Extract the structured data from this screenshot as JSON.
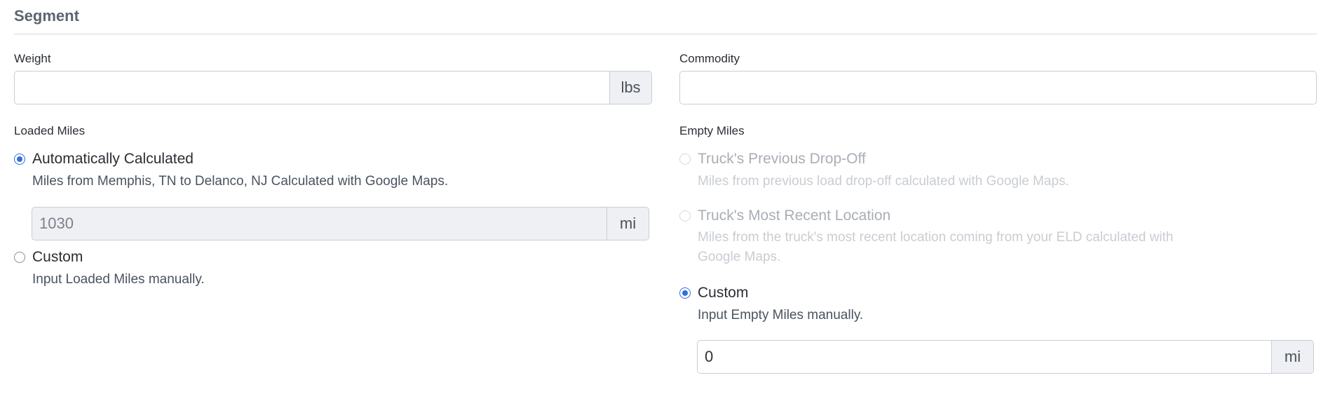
{
  "segment": {
    "title": "Segment"
  },
  "weight": {
    "label": "Weight",
    "value": "",
    "unit": "lbs"
  },
  "commodity": {
    "label": "Commodity",
    "value": ""
  },
  "loaded_miles": {
    "label": "Loaded Miles",
    "options": [
      {
        "label": "Automatically Calculated",
        "help": "Miles from Memphis, TN to Delanco, NJ Calculated with Google Maps.",
        "checked": true,
        "disabled": false
      },
      {
        "label": "Custom",
        "help": "Input Loaded Miles manually.",
        "checked": false,
        "disabled": false
      }
    ],
    "calculated_value": "1030",
    "unit": "mi"
  },
  "empty_miles": {
    "label": "Empty Miles",
    "options": [
      {
        "label": "Truck's Previous Drop-Off",
        "help": "Miles from previous load drop-off calculated with Google Maps.",
        "checked": false,
        "disabled": true
      },
      {
        "label": "Truck's Most Recent Location",
        "help": "Miles from the truck's most recent location coming from your ELD calculated with Google Maps.",
        "checked": false,
        "disabled": true
      },
      {
        "label": "Custom",
        "help": "Input Empty Miles manually.",
        "checked": true,
        "disabled": false
      }
    ],
    "custom_value": "0",
    "unit": "mi"
  },
  "colors": {
    "accent": "#2f6fe0",
    "section_title": "#5c6470",
    "disabled_text": "#a9aeb5",
    "addon_bg": "#eef0f3"
  }
}
